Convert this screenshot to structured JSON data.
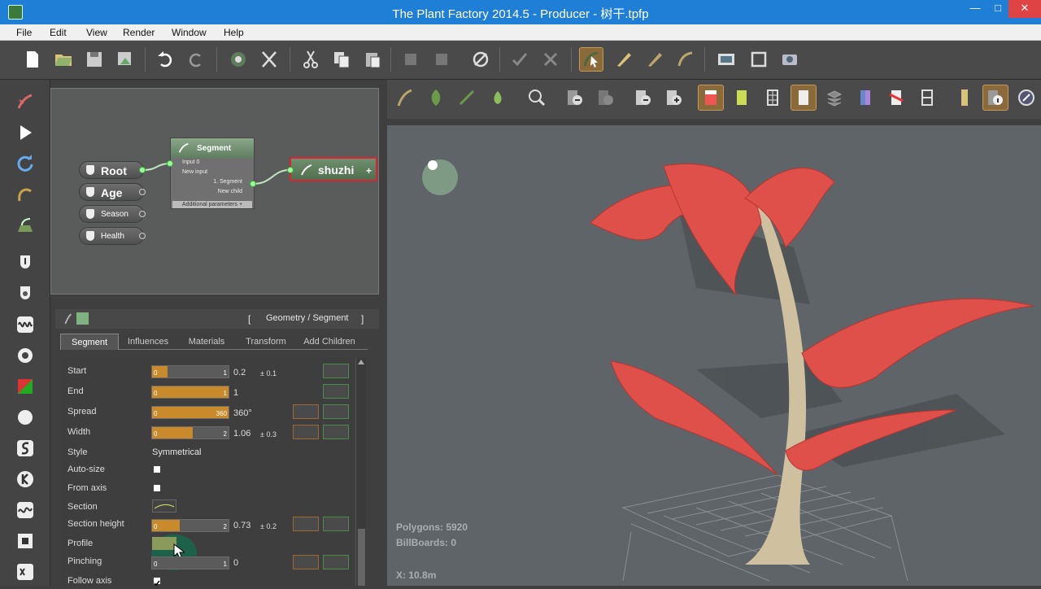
{
  "window": {
    "title": "The Plant Factory 2014.5 - Producer - 树干.tpfp",
    "controls": {
      "minimize": "—",
      "maximize": "□",
      "close": "✕"
    }
  },
  "menu": [
    "File",
    "Edit",
    "View",
    "Render",
    "Window",
    "Help"
  ],
  "toolbar_icons": [
    "new-file-icon",
    "open-folder-icon",
    "save-icon",
    "save-as-icon",
    "undo-icon",
    "redo-icon",
    "plant-library-icon",
    "dna-icon",
    "cut-icon",
    "copy-icon",
    "paste-icon",
    "group-icon",
    "ungroup-icon",
    "disable-icon",
    "check-icon",
    "delete-icon",
    "select-tool-icon",
    "paint-tool-icon",
    "edit-tool-icon",
    "draw-tool-icon",
    "image-icon",
    "frame-icon",
    "render-icon"
  ],
  "graph": {
    "inputs": [
      {
        "label": "Root"
      },
      {
        "label": "Age"
      },
      {
        "label": "Season"
      },
      {
        "label": "Health"
      }
    ],
    "segment_node": {
      "title": "Segment",
      "rows": [
        "Input 0",
        "New input",
        "1. Segment",
        "New child"
      ],
      "additional": "Additional parameters +"
    },
    "output_node": {
      "label": "shuzhi",
      "plus": "+"
    }
  },
  "properties": {
    "header": "Geometry / Segment",
    "bracket_left": "[",
    "bracket_right": "]",
    "tabs": [
      "Segment",
      "Influences",
      "Materials",
      "Transform",
      "Add Children"
    ],
    "rows": [
      {
        "label": "Start",
        "min": "0",
        "max": "1",
        "value": "0.2",
        "variation": "± 0.1",
        "fill": 0.2
      },
      {
        "label": "End",
        "min": "0",
        "max": "1",
        "value": "1",
        "variation": "",
        "fill": 1.0
      },
      {
        "label": "Spread",
        "min": "0",
        "max": "360",
        "value": "360°",
        "variation": "",
        "fill": 1.0
      },
      {
        "label": "Width",
        "min": "0",
        "max": "2",
        "value": "1.06",
        "variation": "± 0.3",
        "fill": 0.53
      },
      {
        "label": "Style",
        "text": "Symmetrical"
      },
      {
        "label": "Auto-size",
        "checked": false
      },
      {
        "label": "From axis",
        "checked": false
      },
      {
        "label": "Section"
      },
      {
        "label": "Section height",
        "min": "0",
        "max": "2",
        "value": "0.73",
        "variation": "± 0.2",
        "fill": 0.36
      },
      {
        "label": "Profile"
      },
      {
        "label": "Pinching",
        "min": "0",
        "max": "1",
        "value": "0",
        "variation": "",
        "fill": 0
      },
      {
        "label": "Follow axis",
        "checked": true
      }
    ]
  },
  "viewport": {
    "polygons": "Polygons: 5920",
    "billboards": "BillBoards: 0",
    "coord": "X: 10.8m"
  },
  "colors": {
    "accent": "#1f7fd6",
    "slider": "#c88a2a",
    "leaf": "#e0504a",
    "trunk": "#cfc0a0",
    "node_green": "#6f8f6f",
    "selected": "#d23"
  }
}
